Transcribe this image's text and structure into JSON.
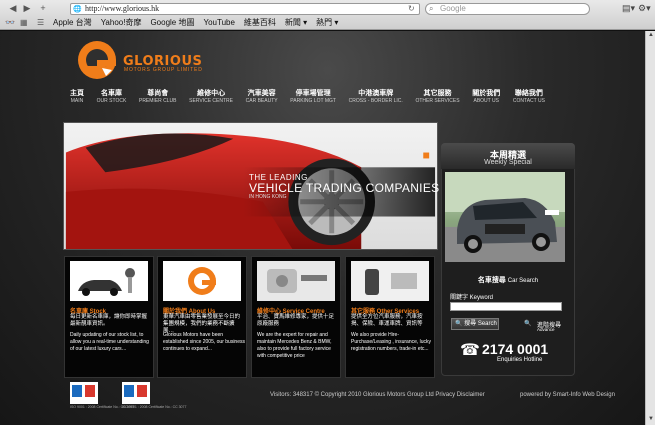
{
  "browser": {
    "url": "http://www.glorious.hk",
    "search_placeholder": "Google",
    "bookmarks": [
      "Apple 台灣",
      "Yahoo!奇摩",
      "Google 地圖",
      "YouTube",
      "維基百科",
      "新聞 ▾",
      "熱門 ▾"
    ]
  },
  "logo": {
    "name": "GLORIOUS",
    "subtitle": "MOTORS GROUP LIMITED"
  },
  "nav": [
    {
      "zh": "主頁",
      "en": "MAIN"
    },
    {
      "zh": "名車庫",
      "en": "OUR STOCK"
    },
    {
      "zh": "尊尚會",
      "en": "PREMIER CLUB"
    },
    {
      "zh": "維修中心",
      "en": "SERVICE CENTRE"
    },
    {
      "zh": "汽車美容",
      "en": "CAR BEAUTY"
    },
    {
      "zh": "停車場管理",
      "en": "PARKING LOT MGT"
    },
    {
      "zh": "中港澳車牌",
      "en": "CROSS - BORDER LIC."
    },
    {
      "zh": "其它服務",
      "en": "OTHER SERVICES"
    },
    {
      "zh": "關於我們",
      "en": "ABOUT US"
    },
    {
      "zh": "聯絡我們",
      "en": "CONTACT US"
    }
  ],
  "hero": {
    "line1": "THE LEADING",
    "line2": "VEHICLE TRADING COMPANIES",
    "line3": "IN HONG KONG"
  },
  "weekly": {
    "title_zh": "本周精選",
    "title_en": "Weekly Special"
  },
  "car_search": {
    "title_zh": "名車搜尋",
    "title_en": "Car Search",
    "keyword_label": "關鍵字 Keyword",
    "search_button": "搜尋 Search",
    "advance_zh": "進階搜尋",
    "advance_en": "Advance"
  },
  "hotline": {
    "number": "2174 0001",
    "label": "Enquiries Hotline"
  },
  "boxes": [
    {
      "title": "名車庫 Stock",
      "zh": "每日更新名車庫，讓你即時掌握最新靚車資訊。",
      "en": "Daily updating of our stock list, to allow you a real-time understanding of our latest luxury cars…"
    },
    {
      "title": "關於我們 About Us",
      "zh": "東華汽車由零售業發展至今日的集團規模，我們的業務不斷擴展…",
      "en": "Glorious Motors have been established since 2005, our business continues to expand..."
    },
    {
      "title": "維修中心 Service Centre",
      "zh": "平治、寶馬維修專家，提供十足原廠服務",
      "en": "We are the expert for repair and maintain Mercedes Benz & BMW, also to provide full factory service with competitive price"
    },
    {
      "title": "其它服務 Other Services",
      "zh": "提供全方位汽車服務，汽車按揭、保險、車運車牌、資訊等",
      "en": "We also provide Hire-Purchase/Leasing , insurance, lucky registration numbers, trade-in etc..."
    }
  ],
  "footer": {
    "text": "Visitors: 348317   © Copyright 2010 Glorious Motors Group Ltd    Privacy    Disclaimer",
    "powered": "powered by Smart-Info Web Design",
    "cert1_caption": "ISO 9001 : 2008  Certificate No.: CC 3077",
    "cert2_caption": "ISO 9001 : 2008  Certificate No.: CC 3077"
  }
}
